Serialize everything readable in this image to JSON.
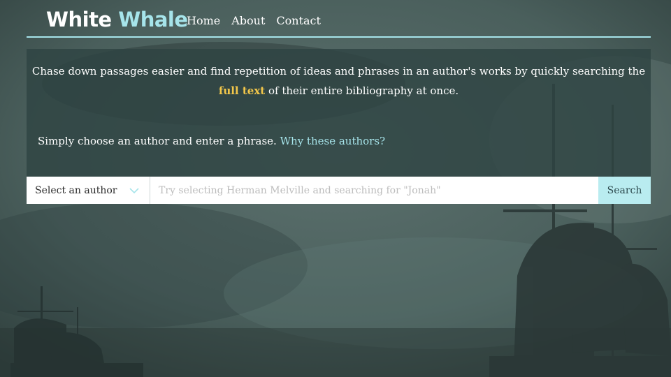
{
  "brand": {
    "part1": "White",
    "part2": "Whale"
  },
  "nav": {
    "items": [
      "Home",
      "About",
      "Contact"
    ]
  },
  "intro": {
    "before": "Chase down passages easier and find repetition of ideas and phrases in an author's works by quickly searching the ",
    "highlight": "full text",
    "after": " of their entire bibliography at once."
  },
  "choose": {
    "text": "Simply choose an author and enter a phrase.",
    "link": "Why these authors?"
  },
  "search": {
    "author_select": "Select an author",
    "placeholder": "Try selecting Herman Melville and searching for \"Jonah\"",
    "button": "Search"
  },
  "colors": {
    "accent": "#a6e4ea",
    "highlight": "#f3c74a",
    "button_bg": "#b9ecf0",
    "panel": "#2e4342"
  },
  "icons": {
    "select_arrow": "chevron-down-icon"
  }
}
